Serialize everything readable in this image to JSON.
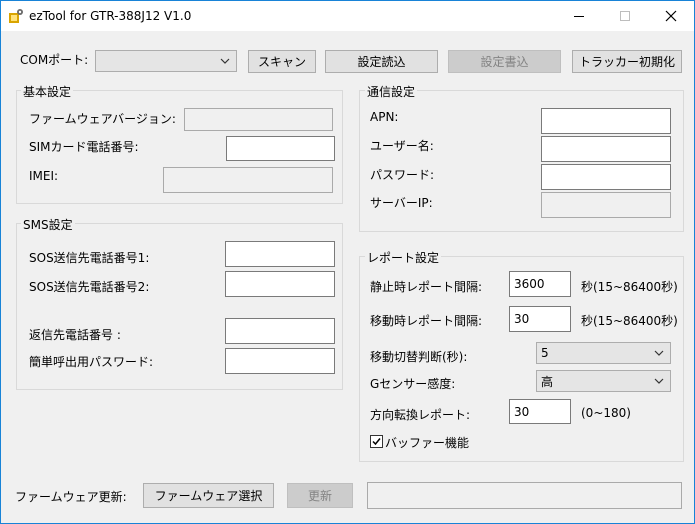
{
  "window": {
    "title": "ezTool for GTR-388J12 V1.0"
  },
  "top": {
    "com_label": "COMポート:",
    "com_value": "",
    "scan_button": "スキャン",
    "read_settings_button": "設定読込",
    "write_settings_button": "設定書込",
    "tracker_init_button": "トラッカー初期化"
  },
  "basic": {
    "title": "基本設定",
    "firmware_label": "ファームウェアバージョン:",
    "firmware_value": "",
    "sim_label": "SIMカード電話番号:",
    "sim_value": "",
    "imei_label": "IMEI:",
    "imei_value": ""
  },
  "sms": {
    "title": "SMS設定",
    "sos1_label": "SOS送信先電話番号1:",
    "sos1_value": "",
    "sos2_label": "SOS送信先電話番号2:",
    "sos2_value": "",
    "reply_label": "返信先電話番号 :",
    "reply_value": "",
    "call_pw_label": "簡単呼出用パスワード:",
    "call_pw_value": ""
  },
  "comm": {
    "title": "通信設定",
    "apn_label": "APN:",
    "apn_value": "",
    "user_label": "ユーザー名:",
    "user_value": "",
    "pw_label": "パスワード:",
    "pw_value": "",
    "server_label": "サーバーIP:",
    "server_value": ""
  },
  "report": {
    "title": "レポート設定",
    "static_label": "静止時レポート間隔:",
    "static_value": "3600",
    "static_unit": "秒(15~86400秒)",
    "moving_label": "移動時レポート間隔:",
    "moving_value": "30",
    "moving_unit": "秒(15~86400秒)",
    "switch_label": "移動切替判断(秒):",
    "switch_value": "5",
    "gsensor_label": "Gセンサー感度:",
    "gsensor_value": "高",
    "direction_label": "方向転換レポート:",
    "direction_value": "30",
    "direction_unit": "(0~180)",
    "buffer_label": "バッファー機能",
    "buffer_checked": true
  },
  "bottom": {
    "fw_update_label": "ファームウェア更新:",
    "fw_select_button": "ファームウェア選択",
    "update_button": "更新",
    "status_value": ""
  }
}
